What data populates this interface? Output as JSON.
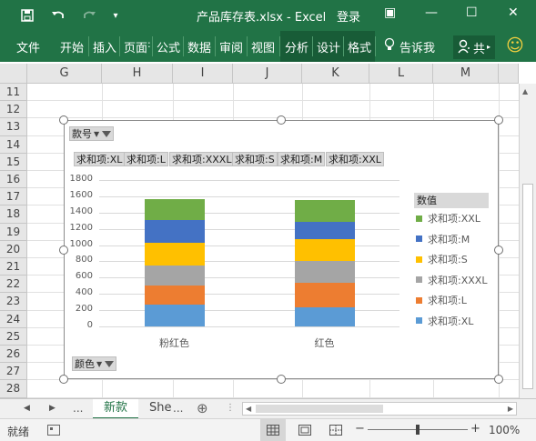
{
  "titlebar": {
    "title": "产品库存表.xlsx - Excel",
    "login": "登录",
    "qa_save": "save-icon",
    "qa_undo": "undo-icon",
    "qa_redo": "redo-icon",
    "qa_more": "▾",
    "win_ribbon": "▣",
    "win_min": "—",
    "win_max": "☐",
    "win_close": "✕"
  },
  "ribbon": {
    "tabs": [
      "文件",
      "开始",
      "插入",
      "页面",
      "公式",
      "数据",
      "审阅",
      "视图",
      "分析",
      "设计",
      "格式"
    ],
    "tellme": "告诉我",
    "share": "共",
    "smile": "☺"
  },
  "grid": {
    "columns": [
      "G",
      "H",
      "I",
      "J",
      "K",
      "L",
      "M"
    ],
    "rows": [
      "11",
      "12",
      "13",
      "14",
      "15",
      "16",
      "17",
      "18",
      "19",
      "20",
      "21",
      "22",
      "23",
      "24",
      "25",
      "26",
      "27",
      "28"
    ]
  },
  "pivot": {
    "filter_field": "款号",
    "axis_field": "颜色",
    "value_buttons": [
      "求和项:XL",
      "求和项:L",
      "求和项:XXXL",
      "求和项:S",
      "求和项:M",
      "求和项:XXL"
    ],
    "legend_title": "数值"
  },
  "chart_data": {
    "type": "bar",
    "stacked": true,
    "categories": [
      "粉红色",
      "红色"
    ],
    "series": [
      {
        "name": "求和项:XL",
        "color": "#5b9bd5",
        "values": [
          270,
          240
        ]
      },
      {
        "name": "求和项:L",
        "color": "#ed7d31",
        "values": [
          230,
          300
        ]
      },
      {
        "name": "求和项:XXXL",
        "color": "#a5a5a5",
        "values": [
          250,
          270
        ]
      },
      {
        "name": "求和项:S",
        "color": "#ffc000",
        "values": [
          280,
          260
        ]
      },
      {
        "name": "求和项:M",
        "color": "#4472c4",
        "values": [
          280,
          220
        ]
      },
      {
        "name": "求和项:XXL",
        "color": "#70ad47",
        "values": [
          260,
          260
        ]
      }
    ],
    "yticks": [
      "0",
      "200",
      "400",
      "600",
      "800",
      "1000",
      "1200",
      "1400",
      "1600",
      "1800"
    ],
    "ylim": [
      0,
      1800
    ],
    "legend_position": "right",
    "grid": true
  },
  "sheets": {
    "nav_prev": "◀",
    "nav_next": "▶",
    "ellipsis": "...",
    "tabs": [
      "新款",
      "She"
    ],
    "add": "⊕",
    "ellipsis2": "..."
  },
  "status": {
    "ready": "就绪",
    "zoom": "100%",
    "zoom_minus": "−",
    "zoom_plus": "+"
  }
}
